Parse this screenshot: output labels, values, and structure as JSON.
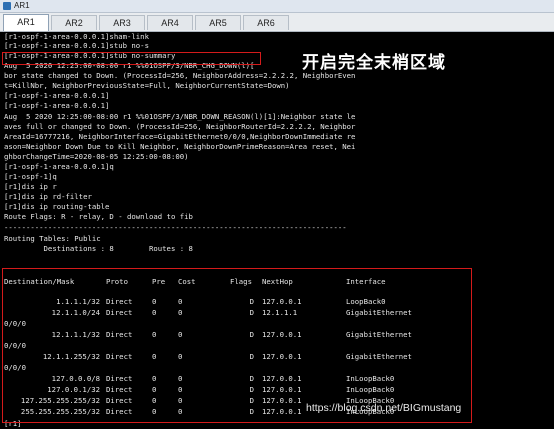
{
  "window": {
    "title": "AR1"
  },
  "tabs": [
    {
      "label": "AR1",
      "active": true
    },
    {
      "label": "AR2",
      "active": false
    },
    {
      "label": "AR3",
      "active": false
    },
    {
      "label": "AR4",
      "active": false
    },
    {
      "label": "AR5",
      "active": false
    },
    {
      "label": "AR6",
      "active": false
    }
  ],
  "terminal": {
    "lines": [
      "[r1-ospf-1-area-0.0.0.1]sham-link",
      "[r1-ospf-1-area-0.0.0.1]stub no-s",
      "[r1-ospf-1-area-0.0.0.1]stub no-summary",
      "Aug  5 2020 12:25:00-08:00 r1 %%01OSPF/3/NBR_CHG_DOWN(l)[",
      "bor state changed to Down. (ProcessId=256, NeighborAddress=2.2.2.2, NeighborEven",
      "t=KillNbr, NeighborPreviousState=Full, NeighborCurrentState=Down)",
      "[r1-ospf-1-area-0.0.0.1]",
      "[r1-ospf-1-area-0.0.0.1]",
      "Aug  5 2020 12:25:00-08:00 r1 %%01OSPF/3/NBR_DOWN_REASON(l)[1]:Neighbor state le",
      "aves full or changed to Down. (ProcessId=256, NeighborRouterId=2.2.2.2, Neighbor",
      "AreaId=16777216, NeighborInterface=GigabitEthernet0/0/0,NeighborDownImmediate re",
      "ason=Neighbor Down Due to Kill Neighbor, NeighborDownPrimeReason=Area reset, Nei",
      "ghborChangeTime=2020-08-05 12:25:00-08:00)",
      "[r1-ospf-1-area-0.0.0.1]q",
      "[r1-ospf-1]q",
      "[r1]dis ip r",
      "[r1]dis ip rd-filter",
      "[r1]dis ip routing-table",
      "Route Flags: R - relay, D - download to fib",
      "------------------------------------------------------------------------------",
      "Routing Tables: Public",
      "         Destinations : 8        Routes : 8"
    ],
    "last_line": "[r1]"
  },
  "route_table": {
    "headers": [
      "Destination/Mask",
      "Proto",
      "Pre",
      "Cost",
      "Flags",
      "NextHop",
      "Interface"
    ],
    "rows": [
      {
        "dest": "1.1.1.1/32",
        "proto": "Direct",
        "pre": "0",
        "cost": "0",
        "flags": "D",
        "nexthop": "127.0.0.1",
        "iface": "LoopBack0",
        "wrap": ""
      },
      {
        "dest": "12.1.1.0/24",
        "proto": "Direct",
        "pre": "0",
        "cost": "0",
        "flags": "D",
        "nexthop": "12.1.1.1",
        "iface": "GigabitEthernet",
        "wrap": "0/0/0"
      },
      {
        "dest": "12.1.1.1/32",
        "proto": "Direct",
        "pre": "0",
        "cost": "0",
        "flags": "D",
        "nexthop": "127.0.0.1",
        "iface": "GigabitEthernet",
        "wrap": "0/0/0"
      },
      {
        "dest": "12.1.1.255/32",
        "proto": "Direct",
        "pre": "0",
        "cost": "0",
        "flags": "D",
        "nexthop": "127.0.0.1",
        "iface": "GigabitEthernet",
        "wrap": "0/0/0"
      },
      {
        "dest": "127.0.0.0/8",
        "proto": "Direct",
        "pre": "0",
        "cost": "0",
        "flags": "D",
        "nexthop": "127.0.0.1",
        "iface": "InLoopBack0",
        "wrap": ""
      },
      {
        "dest": "127.0.0.1/32",
        "proto": "Direct",
        "pre": "0",
        "cost": "0",
        "flags": "D",
        "nexthop": "127.0.0.1",
        "iface": "InLoopBack0",
        "wrap": ""
      },
      {
        "dest": "127.255.255.255/32",
        "proto": "Direct",
        "pre": "0",
        "cost": "0",
        "flags": "D",
        "nexthop": "127.0.0.1",
        "iface": "InLoopBack0",
        "wrap": ""
      },
      {
        "dest": "255.255.255.255/32",
        "proto": "Direct",
        "pre": "0",
        "cost": "0",
        "flags": "D",
        "nexthop": "127.0.0.1",
        "iface": "InLoopBack0",
        "wrap": ""
      }
    ]
  },
  "annotation": "开启完全末梢区域",
  "watermark": "https://blog.csdn.net/BIGmustang",
  "colors": {
    "highlight": "#d41b1b",
    "terminal_bg": "#000000",
    "text": "#e6e6e6"
  }
}
